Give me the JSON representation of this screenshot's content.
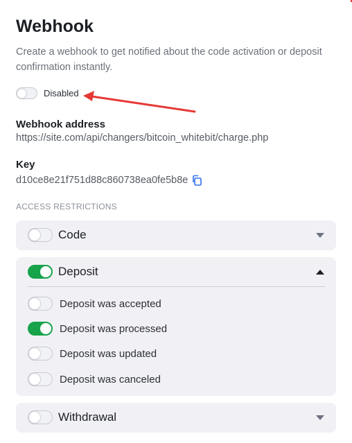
{
  "webhook": {
    "title": "Webhook",
    "description": "Create a webhook to get notified about the code activation or deposit confirmation instantly.",
    "enabled": false,
    "status_label": "Disabled"
  },
  "address": {
    "label": "Webhook address",
    "value": "https://site.com/api/changers/bitcoin_whitebit/charge.php"
  },
  "key": {
    "label": "Key",
    "value": "d10ce8e21f751d88c860738ea0fe5b8e"
  },
  "access": {
    "title": "ACCESS RESTRICTIONS",
    "groups": [
      {
        "label": "Code",
        "enabled": false,
        "expanded": false
      },
      {
        "label": "Deposit",
        "enabled": true,
        "expanded": true,
        "items": [
          {
            "label": "Deposit was accepted",
            "enabled": false
          },
          {
            "label": "Deposit was processed",
            "enabled": true
          },
          {
            "label": "Deposit was updated",
            "enabled": false
          },
          {
            "label": "Deposit was canceled",
            "enabled": false
          }
        ]
      },
      {
        "label": "Withdrawal",
        "enabled": false,
        "expanded": false
      }
    ]
  },
  "colors": {
    "toggle_on": "#17a34a",
    "panel_bg": "#f1f1f5",
    "annotation_arrow": "#e53935",
    "copy_icon": "#2f6fed"
  },
  "icons": {
    "copy": "copy-icon",
    "expand": "chevron-down-icon",
    "collapse": "chevron-up-icon",
    "annotation": "annotation-arrow"
  }
}
